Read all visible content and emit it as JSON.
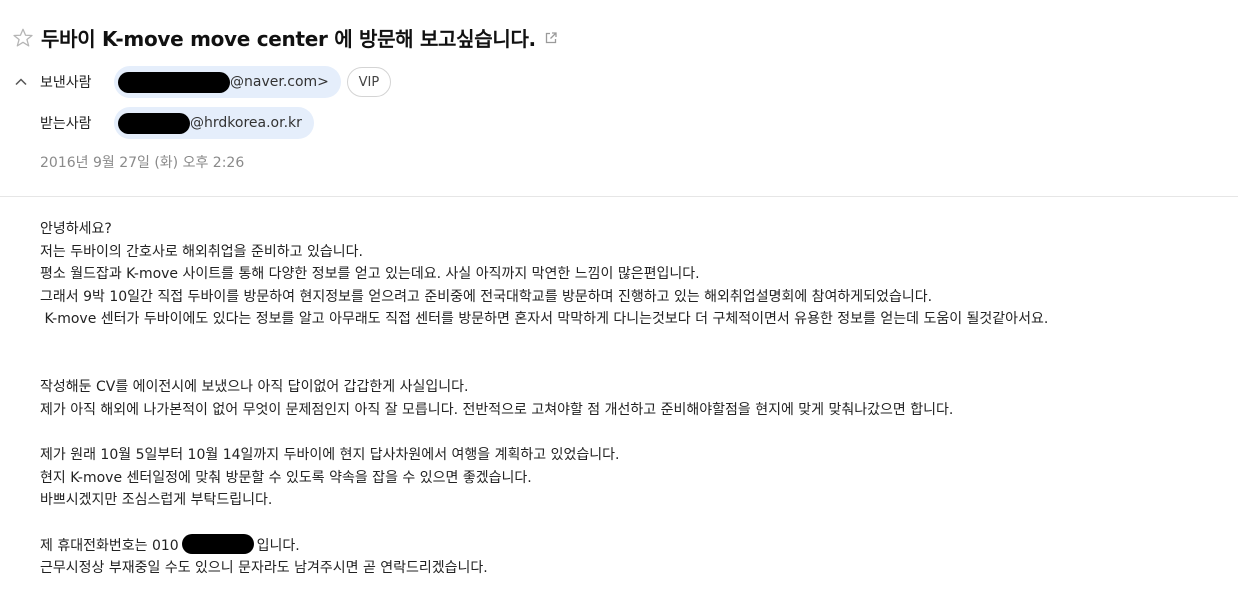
{
  "email": {
    "subject": "두바이 K-move move center 에 방문해 보고싶습니다.",
    "sender_label": "보낸사람",
    "sender_email_visible": "@naver.com>",
    "vip_label": "VIP",
    "recipient_label": "받는사람",
    "recipient_email_visible": "@hrdkorea.or.kr",
    "date": "2016년 9월 27일 (화) 오후 2:26"
  },
  "body": {
    "p1": [
      "안녕하세요?",
      "저는 두바이의 간호사로 해외취업을 준비하고 있습니다.",
      "평소 월드잡과 K-move 사이트를 통해 다양한 정보를 얻고 있는데요. 사실 아직까지 막연한 느낌이 많은편입니다.",
      "그래서 9박 10일간 직접 두바이를 방문하여 현지정보를 얻으려고 준비중에 전국대학교를 방문하며 진행하고 있는 해외취업설명회에 참여하게되었습니다.",
      " K-move 센터가 두바이에도 있다는 정보를 알고 아무래도 직접 센터를 방문하면 혼자서 막막하게 다니는것보다 더 구체적이면서 유용한 정보를 얻는데 도움이 될것같아서요."
    ],
    "p2": [
      "작성해둔 CV를 에이전시에 보냈으나 아직 답이없어 갑갑한게 사실입니다.",
      "제가 아직 해외에 나가본적이 없어 무엇이 문제점인지 아직 잘 모릅니다. 전반적으로 고쳐야할 점 개선하고 준비해야할점을 현지에 맞게 맞춰나갔으면 합니다."
    ],
    "p3": [
      "제가 원래 10월 5일부터 10월 14일까지 두바이에 현지 답사차원에서 여행을 계획하고 있었습니다.",
      "현지 K-move 센터일정에 맞춰 방문할 수 있도록 약속을 잡을 수 있으면 좋겠습니다.",
      "바쁘시겠지만 조심스럽게 부탁드립니다."
    ],
    "phone_prefix": "제 휴대전화번호는 010",
    "phone_suffix": "입니다.",
    "closing": "근무시정상 부재중일 수도 있으니 문자라도 남겨주시면 곧 연락드리겠습니다."
  },
  "icons": {
    "star": "star-outline-icon",
    "popout": "popout-window-icon",
    "chevron": "chevron-up-icon"
  },
  "colors": {
    "chip_bg": "#e5eefb",
    "date": "#8a8a8a",
    "redaction": "#000000"
  }
}
